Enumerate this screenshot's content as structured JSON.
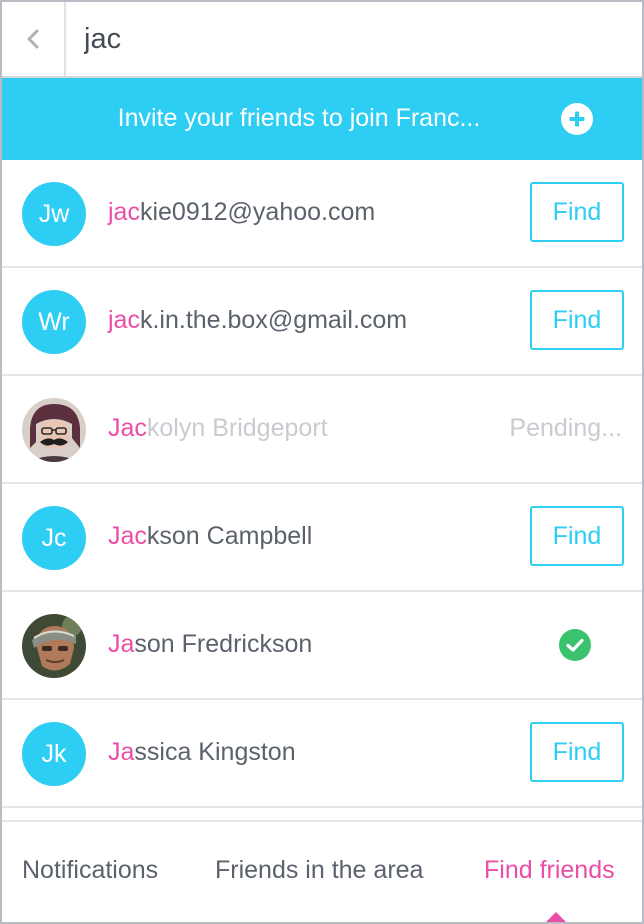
{
  "search": {
    "value": "jac",
    "back_icon": "chevron-left-icon"
  },
  "banner": {
    "text": "Invite your friends to join Franc...",
    "icon": "plus-circle-icon"
  },
  "colors": {
    "accent": "#2ecdf3",
    "highlight": "#ea4ea6",
    "success": "#3ac36c"
  },
  "results": [
    {
      "initials": "Jw",
      "match": "jac",
      "rest": "kie0912@yahoo.com",
      "action": "Find"
    },
    {
      "initials": "Wr",
      "match": "jac",
      "rest": "k.in.the.box@gmail.com",
      "action": "Find"
    },
    {
      "match": "Jac",
      "rest": "kolyn Bridgeport",
      "status": "Pending..."
    },
    {
      "initials": "Jc",
      "match": "Jac",
      "rest": "kson Campbell",
      "action": "Find"
    },
    {
      "match": "Ja",
      "rest": "son Fredrickson",
      "status_icon": "check-circle-icon"
    },
    {
      "initials": "Jk",
      "match": "Ja",
      "rest": "ssica Kingston",
      "action": "Find"
    }
  ],
  "tabs": [
    {
      "label": "Notifications"
    },
    {
      "label": "Friends in the area"
    },
    {
      "label": "Find friends",
      "active": true
    }
  ]
}
